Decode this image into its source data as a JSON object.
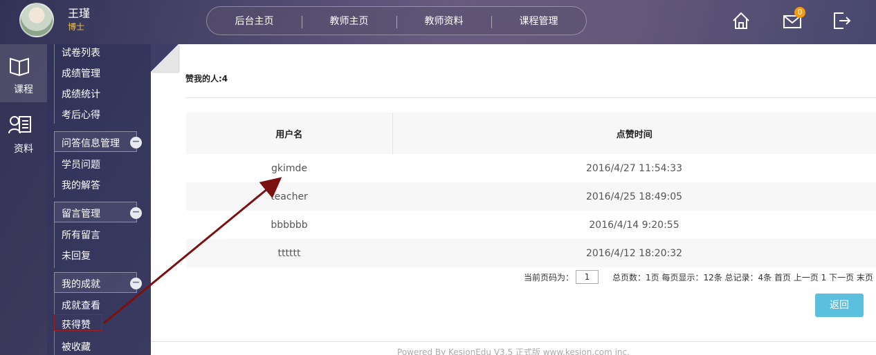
{
  "header": {
    "user_name": "王瑾",
    "user_title": "博士",
    "nav": [
      "后台主页",
      "教师主页",
      "教师资料",
      "课程管理"
    ],
    "mail_count": "0"
  },
  "side_narrow": [
    {
      "label": "课程",
      "icon": "book-icon"
    },
    {
      "label": "资料",
      "icon": "profile-icon"
    }
  ],
  "menu": {
    "top_items": [
      "试卷列表",
      "成绩管理",
      "成绩统计",
      "考后心得"
    ],
    "groups": [
      {
        "title": "问答信息管理",
        "items": [
          "学员问题",
          "我的解答"
        ]
      },
      {
        "title": "留言管理",
        "items": [
          "所有留言",
          "未回复"
        ]
      },
      {
        "title": "我的成就",
        "items": [
          "成就查看",
          "获得赞",
          "被收藏"
        ]
      }
    ],
    "collapse_symbol": "−"
  },
  "main": {
    "likes_label": "赞我的人:4",
    "table": {
      "headers": [
        "用户名",
        "点赞时间"
      ],
      "rows": [
        [
          "gkimde",
          "2016/4/27 11:54:33"
        ],
        [
          "teacher",
          "2016/4/25 18:49:05"
        ],
        [
          "bbbbbb",
          "2016/4/14 9:20:55"
        ],
        [
          "tttttt",
          "2016/4/12 18:20:32"
        ]
      ]
    },
    "pager": {
      "current_label": "当前页码为：",
      "current_page": "1",
      "info": "总页数：1页 每页显示：12条 总记录：4条 首页 上一页 1 下一页 末页"
    },
    "back_label": "返回",
    "footer": "Powered By KesionEdu V3.5 正式版 www.kesion.com inc."
  }
}
